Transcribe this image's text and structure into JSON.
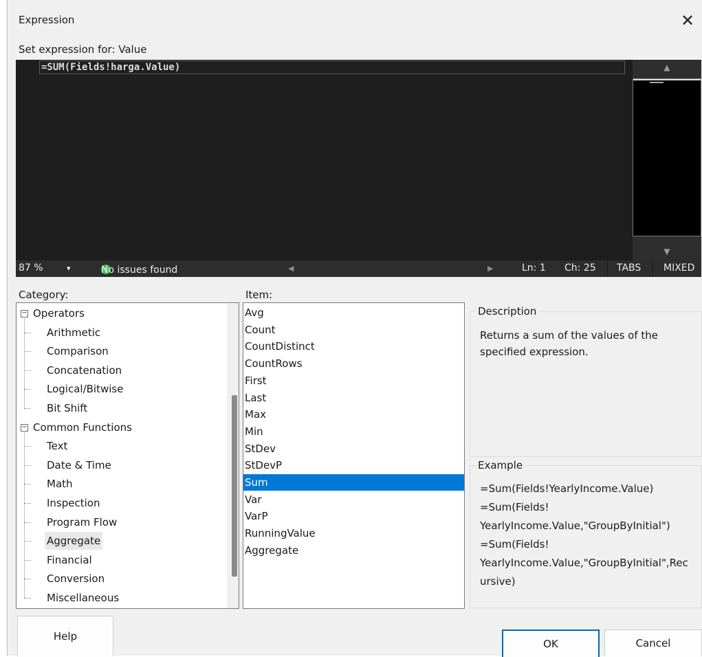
{
  "window": {
    "title": "Expression",
    "close_glyph": "✕"
  },
  "editor": {
    "label": "Set expression for: Value",
    "code": "=SUM(Fields!harga.Value)",
    "scroll_up_glyph": "▲",
    "scroll_down_glyph": "▼"
  },
  "statusbar": {
    "zoom": "87 %",
    "zoom_dropdown_glyph": "▾",
    "issues": "No issues found",
    "scroll_left_glyph": "◀",
    "scroll_right_glyph": "▶",
    "line": "Ln: 1",
    "char": "Ch: 25",
    "tabs": "TABS",
    "mixed": "MIXED"
  },
  "category": {
    "label": "Category:",
    "groups": [
      {
        "label": "Operators",
        "children": [
          "Arithmetic",
          "Comparison",
          "Concatenation",
          "Logical/Bitwise",
          "Bit Shift"
        ]
      },
      {
        "label": "Common Functions",
        "children": [
          "Text",
          "Date & Time",
          "Math",
          "Inspection",
          "Program Flow",
          "Aggregate",
          "Financial",
          "Conversion",
          "Miscellaneous"
        ]
      }
    ],
    "selected": "Aggregate"
  },
  "item": {
    "label": "Item:",
    "items": [
      "Avg",
      "Count",
      "CountDistinct",
      "CountRows",
      "First",
      "Last",
      "Max",
      "Min",
      "StDev",
      "StDevP",
      "Sum",
      "Var",
      "VarP",
      "RunningValue",
      "Aggregate"
    ],
    "selected": "Sum"
  },
  "description": {
    "title": "Description",
    "text": "Returns a sum of the values of the specified expression."
  },
  "example": {
    "title": "Example",
    "lines": [
      "=Sum(Fields!YearlyIncome.Value)",
      "=Sum(Fields!",
      "YearlyIncome.Value,\"GroupByInitial\")",
      "=Sum(Fields!",
      "YearlyIncome.Value,\"GroupByInitial\",Rec",
      "ursive)"
    ]
  },
  "buttons": {
    "help": "Help",
    "ok": "OK",
    "cancel": "Cancel"
  },
  "colors": {
    "editor_bg": "#1e1e1e",
    "selection": "#0078d7",
    "ok_icon": "#3cba54",
    "dialog_bg": "#f0f0f0"
  }
}
